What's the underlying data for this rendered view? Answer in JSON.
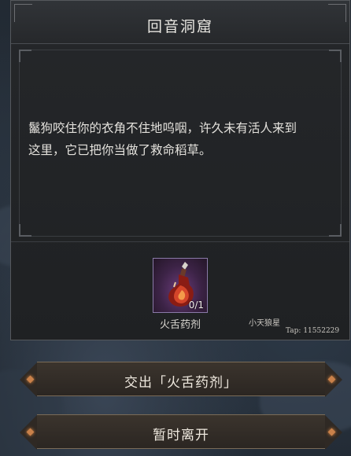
{
  "dialog": {
    "title": "回音洞窟",
    "story_line1": "鬣狗咬住你的衣角不住地呜咽，许久未有活人来到",
    "story_line2": "这里，它已把你当做了救命稻草。"
  },
  "item": {
    "name": "火舌药剂",
    "count": "0/1",
    "icon": "red-potion-icon"
  },
  "watermark": {
    "name": "小天狼星",
    "id": "Tap: 11552229"
  },
  "actions": {
    "submit_label": "交出「火舌药剂」",
    "leave_label": "暂时离开"
  },
  "colors": {
    "button_accent": "#c9814a",
    "item_rarity": "#6a3b7a"
  }
}
